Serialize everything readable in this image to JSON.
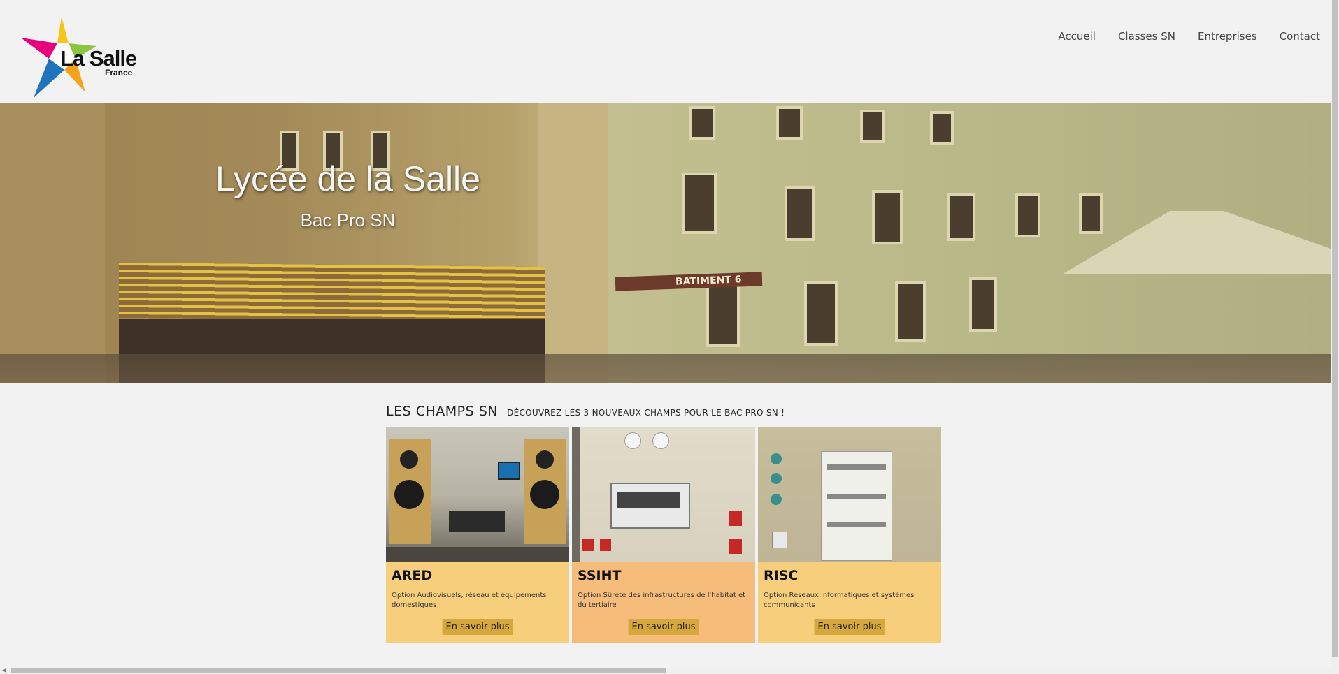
{
  "brand": {
    "name": "La Salle",
    "sub": "France"
  },
  "nav": [
    {
      "label": "Accueil"
    },
    {
      "label": "Classes SN"
    },
    {
      "label": "Entreprises"
    },
    {
      "label": "Contact"
    }
  ],
  "hero": {
    "title": "Lycée de la Salle",
    "subtitle": "Bac Pro SN",
    "sign_text": "BATIMENT 6"
  },
  "section": {
    "title": "LES CHAMPS SN",
    "subtitle": "DÉCOUVREZ LES 3 NOUVEAUX CHAMPS POUR LE BAC PRO SN !"
  },
  "cards": [
    {
      "title": "ARED",
      "description": "Option Audiovisuels, réseau et équipements domestiques",
      "button": "En savoir plus",
      "color": "#f7cf7c"
    },
    {
      "title": "SSIHT",
      "description": "Option Sûreté des infrastructures de l'habitat et du tertiaire",
      "button": "En savoir plus",
      "color": "#f6bd7a"
    },
    {
      "title": "RISC",
      "description": "Option Réseaux informatiques et systèmes communicants",
      "button": "En savoir plus",
      "color": "#f7cf7c"
    }
  ],
  "colors": {
    "background": "#f2f2f2",
    "button": "#d6a73d"
  }
}
